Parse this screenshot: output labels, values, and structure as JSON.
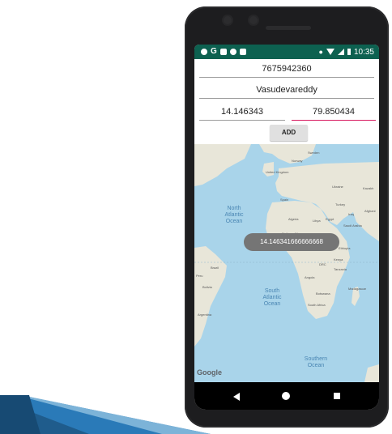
{
  "status_bar": {
    "time": "10:35",
    "notification_icons": [
      "shield-icon",
      "google-icon",
      "message-icon",
      "settings-icon",
      "sd-card-icon"
    ]
  },
  "form": {
    "phone_value": "7675942360",
    "name_value": "Vasudevareddy",
    "latitude_value": "14.146343",
    "longitude_value": "79.850434",
    "add_label": "ADD"
  },
  "map": {
    "ocean_labels": {
      "north_atlantic": "North\nAtlantic\nOcean",
      "south_atlantic": "South\nAtlantic\nOcean",
      "southern": "Southern\nOcean"
    },
    "country_labels": [
      "Sweden",
      "Norway",
      "United Kingdom",
      "Ukraine",
      "Kazakh",
      "Spain",
      "Turkey",
      "Algeria",
      "Libya",
      "Egypt",
      "Iraq",
      "Afghani",
      "Saudi Arabia",
      "Mali",
      "Niger",
      "Chad",
      "Sudan",
      "Nigeria",
      "Ethiopia",
      "Kenya",
      "DRC",
      "Tanzania",
      "Angola",
      "Madagascar",
      "Botswana",
      "South Africa",
      "Brazil",
      "Peru",
      "Bolivia",
      "Argentina"
    ],
    "attribution": "Google"
  },
  "toast": {
    "text": "14.146341666666668"
  },
  "colors": {
    "statusbar": "#0d6150",
    "accent": "#d81b60",
    "ocean": "#a9d4ea",
    "land": "#e8e6d9"
  }
}
